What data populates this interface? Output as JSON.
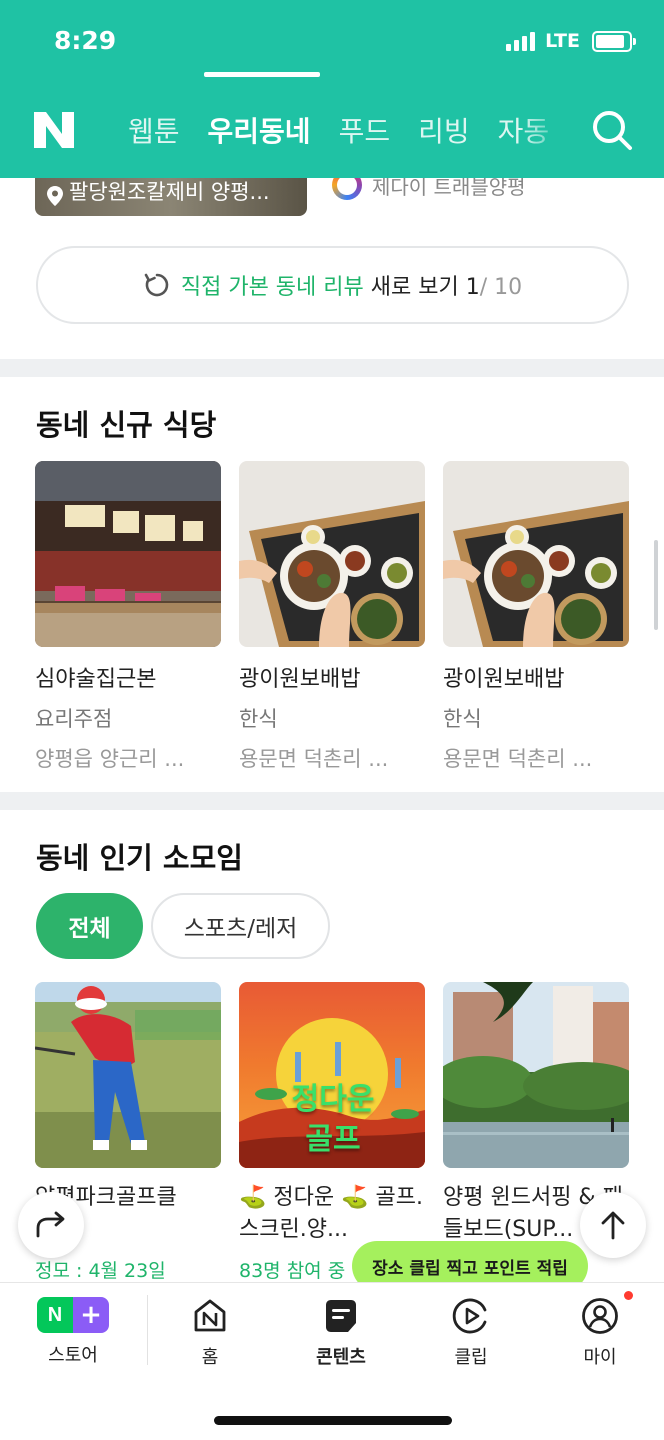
{
  "status": {
    "time": "8:29",
    "network": "LTE"
  },
  "nav": {
    "logo": "N",
    "tabs": [
      "웹툰",
      "우리동네",
      "푸드",
      "리빙",
      "자동"
    ],
    "active_tab": "우리동네"
  },
  "prev_review": {
    "place": "팔당원조칼제비 양평...",
    "author": "제다이 트래블양평"
  },
  "review_button": {
    "green_text": "직접 가본 동네 리뷰",
    "dark_text": "새로 보기",
    "page": "1",
    "total": "/ 10"
  },
  "new_restaurants": {
    "title": "동네 신규 식당",
    "items": [
      {
        "name": "심야술집근본",
        "category": "요리주점",
        "address": "양평읍 양근리 ..."
      },
      {
        "name": "광이원보배밥",
        "category": "한식",
        "address": "용문면 덕촌리 ..."
      },
      {
        "name": "광이원보배밥",
        "category": "한식",
        "address": "용문면 덕촌리 ..."
      }
    ]
  },
  "clubs": {
    "title": "동네 인기 소모임",
    "filters": [
      "전체",
      "스포츠/레저"
    ],
    "active_filter": "전체",
    "items": [
      {
        "title": "양평파크골프클",
        "meta": "정모 : 4월 23일"
      },
      {
        "title": "⛳ 정다운 ⛳ 골프.스크린.양...",
        "meta": "83명 참여 중",
        "image_text": "정다운 골프"
      },
      {
        "title": "양평 윈드서핑 & 패들보드(SUP...",
        "meta": ""
      }
    ]
  },
  "tooltip": "장소 클립 찍고 포인트 적립",
  "bottom_nav": {
    "items": [
      {
        "label": "스토어",
        "icon": "store-logo-icon"
      },
      {
        "label": "홈",
        "icon": "home-n-icon"
      },
      {
        "label": "콘텐츠",
        "icon": "contents-icon"
      },
      {
        "label": "클립",
        "icon": "clip-play-icon"
      },
      {
        "label": "마이",
        "icon": "profile-icon"
      }
    ],
    "active": "콘텐츠"
  },
  "colors": {
    "brand": "#1fc2a4",
    "accent_green": "#2db36b",
    "tooltip": "#a5f05d"
  }
}
